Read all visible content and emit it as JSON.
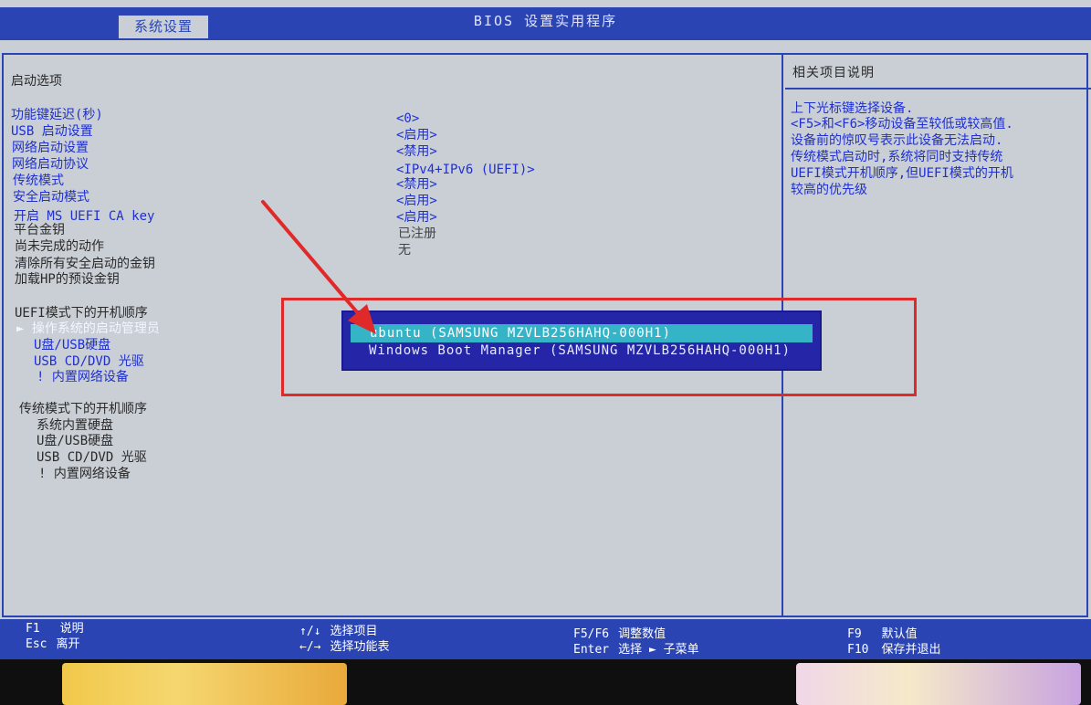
{
  "header": {
    "title": "BIOS 设置实用程序",
    "active_tab": "系统设置"
  },
  "left_panel": {
    "section_title": "启动选项",
    "settings": [
      {
        "label": "功能键延迟(秒)",
        "value": "<0>"
      },
      {
        "label": "USB 启动设置",
        "value": "<启用>"
      },
      {
        "label": "网络启动设置",
        "value": "<禁用>"
      },
      {
        "label": "网络启动协议",
        "value": "<IPv4+IPv6 (UEFI)>"
      },
      {
        "label": "传统模式",
        "value": "<禁用>"
      },
      {
        "label": "安全启动模式",
        "value": "<启用>"
      },
      {
        "label": "开启 MS UEFI CA key",
        "value": "<启用>"
      },
      {
        "label": "平台金钥",
        "value": "已注册"
      },
      {
        "label": "尚未完成的动作",
        "value": "无"
      },
      {
        "label": "清除所有安全启动的金钥",
        "value": ""
      },
      {
        "label": "加载HP的预设金钥",
        "value": ""
      }
    ],
    "uefi_order_title": "UEFI模式下的开机顺序",
    "uefi_order": [
      "► 操作系统的启动管理员",
      "U盘/USB硬盘",
      "USB CD/DVD 光驱",
      "! 内置网络设备"
    ],
    "legacy_order_title": "传统模式下的开机顺序",
    "legacy_order": [
      "系统内置硬盘",
      "U盘/USB硬盘",
      "USB CD/DVD 光驱",
      "! 内置网络设备"
    ]
  },
  "popup": {
    "items": [
      "ubuntu (SAMSUNG MZVLB256HAHQ-000H1)",
      "Windows Boot Manager (SAMSUNG MZVLB256HAHQ-000H1)"
    ],
    "selected_index": 0
  },
  "help_panel": {
    "title": "相关项目说明",
    "lines": [
      "上下光标键选择设备.",
      "<F5>和<F6>移动设备至较低或较高值.",
      "设备前的惊叹号表示此设备无法启动.",
      "传统模式启动时,系统将同时支持传统",
      "UEFI模式开机顺序,但UEFI模式的开机",
      "较高的优先级"
    ]
  },
  "footer": {
    "keys": [
      {
        "key": "F1",
        "desc": "说明"
      },
      {
        "key": "Esc",
        "desc": "离开"
      },
      {
        "key": "↑/↓",
        "desc": "选择项目"
      },
      {
        "key": "←/→",
        "desc": "选择功能表"
      },
      {
        "key": "F5/F6",
        "desc": "调整数值"
      },
      {
        "key": "Enter",
        "desc": "选择 ► 子菜单"
      },
      {
        "key": "F9",
        "desc": "默认值"
      },
      {
        "key": "F10",
        "desc": "保存并退出"
      }
    ]
  },
  "colors": {
    "bios_blue": "#2a45b3",
    "screen_bg": "#c9cfd5",
    "popup_bg": "#2525a8",
    "selection": "#35b4c8",
    "annotation": "#e02a2a"
  }
}
